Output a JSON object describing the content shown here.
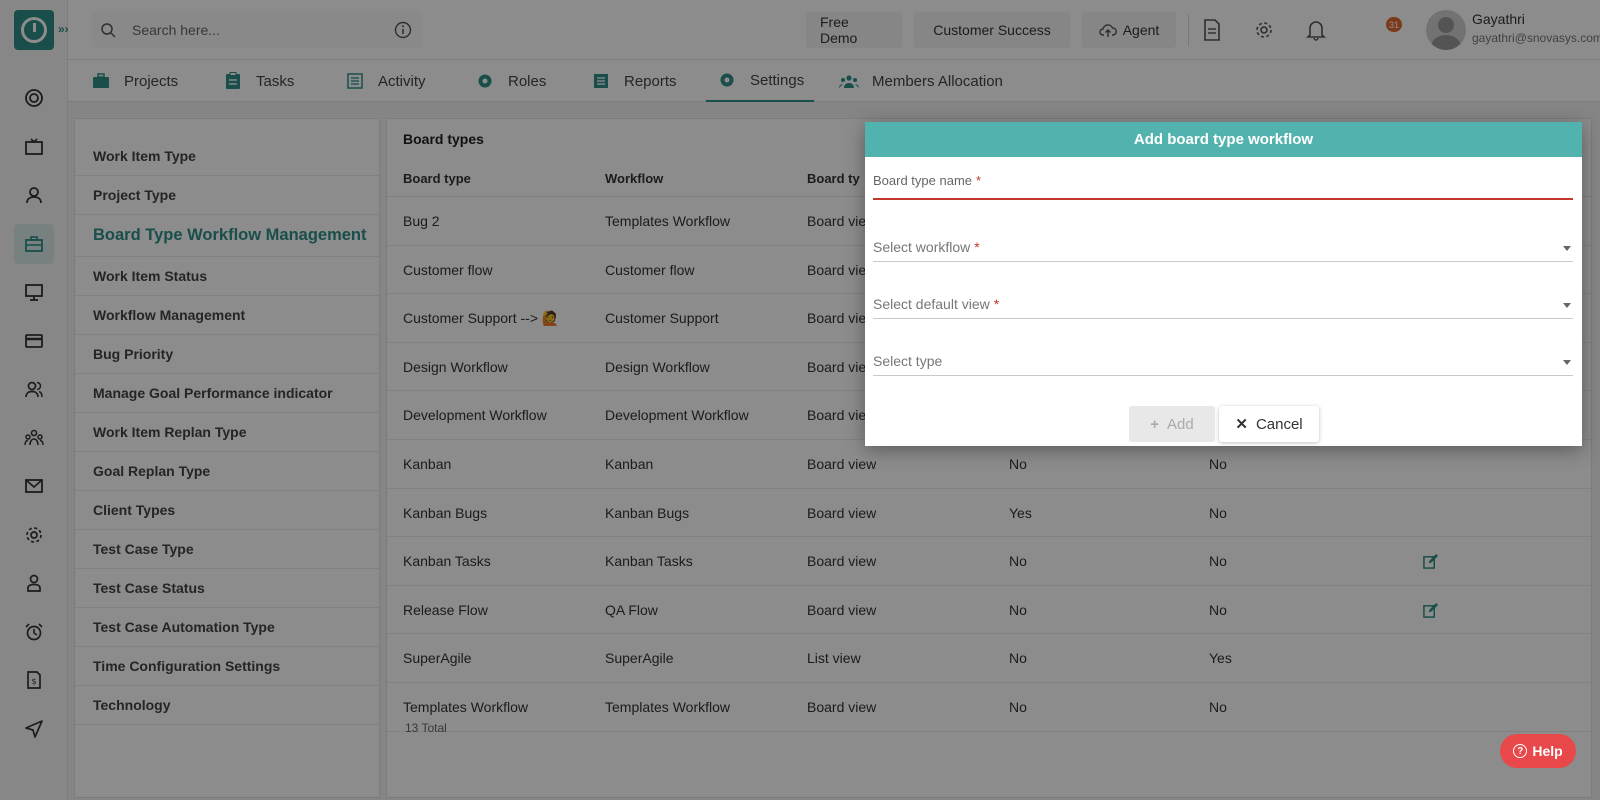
{
  "search": {
    "placeholder": "Search here..."
  },
  "header": {
    "free_demo": "Free Demo",
    "customer_success": "Customer Success",
    "agent": "Agent",
    "notification_count": "31",
    "user_name": "Gayathri",
    "user_email": "gayathri@snovasys.com"
  },
  "nav": {
    "tabs": [
      {
        "label": "Projects",
        "icon": "briefcase-icon"
      },
      {
        "label": "Tasks",
        "icon": "clipboard-icon"
      },
      {
        "label": "Activity",
        "icon": "list-icon"
      },
      {
        "label": "Roles",
        "icon": "gear-icon"
      },
      {
        "label": "Reports",
        "icon": "report-icon"
      },
      {
        "label": "Settings",
        "icon": "gear-icon"
      },
      {
        "label": "Members Allocation",
        "icon": "members-icon"
      }
    ],
    "active_tab": "Settings"
  },
  "side_menu": {
    "items": [
      "Work Item Type",
      "Project Type",
      "Board Type Workflow Management",
      "Work Item Status",
      "Workflow Management",
      "Bug Priority",
      "Manage Goal Performance indicator",
      "Work Item Replan Type",
      "Goal Replan Type",
      "Client Types",
      "Test Case Type",
      "Test Case Status",
      "Test Case Automation Type",
      "Time Configuration Settings",
      "Technology"
    ],
    "active_item": "Board Type Workflow Management"
  },
  "panel": {
    "title": "Board types",
    "columns": [
      "Board type",
      "Workflow",
      "Board ty"
    ],
    "rows": [
      [
        "Bug 2",
        "Templates Workflow",
        "Board view",
        "",
        ""
      ],
      [
        "Customer flow",
        "Customer flow",
        "Board view",
        "",
        ""
      ],
      [
        "Customer Support --> 🙋",
        "Customer Support",
        "Board view",
        "",
        ""
      ],
      [
        "Design Workflow",
        "Design Workflow",
        "Board view",
        "",
        ""
      ],
      [
        "Development Workflow",
        "Development Workflow",
        "Board view",
        "",
        ""
      ],
      [
        "Kanban",
        "Kanban",
        "Board view",
        "No",
        "No"
      ],
      [
        "Kanban Bugs",
        "Kanban Bugs",
        "Board view",
        "Yes",
        "No"
      ],
      [
        "Kanban Tasks",
        "Kanban Tasks",
        "Board view",
        "No",
        "No"
      ],
      [
        "Release Flow",
        "QA Flow",
        "Board view",
        "No",
        "No"
      ],
      [
        "SuperAgile",
        "SuperAgile",
        "List view",
        "No",
        "Yes"
      ],
      [
        "Templates Workflow",
        "Templates Workflow",
        "Board view",
        "No",
        "No"
      ]
    ],
    "total": "13 Total"
  },
  "modal": {
    "title": "Add board type workflow",
    "fields": {
      "board_type_name": "Board type name",
      "select_workflow": "Select workflow",
      "select_default_view": "Select default view",
      "select_type": "Select type"
    },
    "add_label": "Add",
    "cancel_label": "Cancel"
  },
  "help_label": "Help",
  "colors": {
    "accent": "#2e8f89",
    "modal_header": "#52b3ae",
    "required": "#c0392b",
    "help": "#e8484a"
  }
}
